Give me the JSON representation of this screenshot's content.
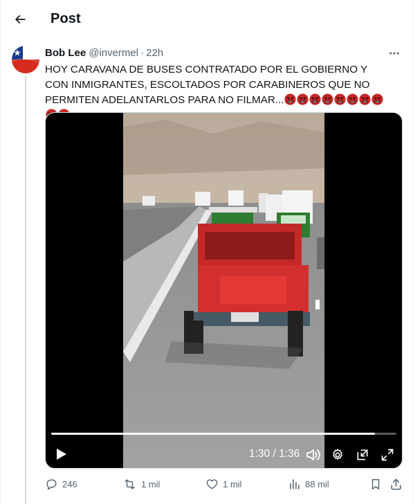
{
  "header": {
    "title": "Post",
    "back_icon": "arrow-left-icon"
  },
  "post": {
    "author_name": "Bob Lee",
    "author_handle": "@invermel",
    "separator": "·",
    "time": "22h",
    "text": "HOY CARAVANA DE BUSES CONTRATADO POR EL GOBIERNO Y CON INMIGRANTES, ESCOLTADOS POR CARABINEROS QUE NO PERMITEN ADELANTARLOS PARA NO FILMAR...",
    "emoji_icon": "angry-face-with-symbols-icon",
    "emoji_count": 10
  },
  "video": {
    "time_readout": "1:30 / 1:36",
    "progress": 0.9375
  },
  "actions": {
    "replies": "246",
    "reposts": "1 mil",
    "likes": "1 mil",
    "views": "88 mil"
  },
  "colors": {
    "text_primary": "#0f1419",
    "text_secondary": "#536471",
    "border": "#cfd9de",
    "emoji_red": "#c62828"
  }
}
